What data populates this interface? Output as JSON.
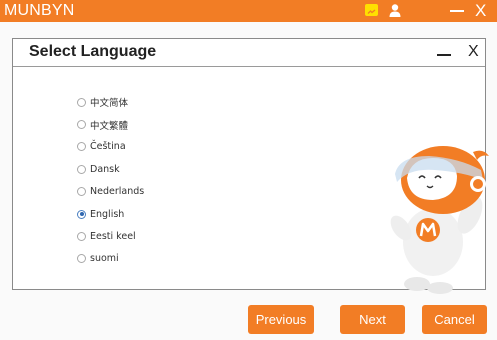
{
  "app": {
    "title": "MUNBYN",
    "close_glyph": "X",
    "accent_color": "#f27d25"
  },
  "dialog": {
    "title": "Select Language",
    "close_glyph": "X"
  },
  "languages": [
    {
      "label": "中文简体",
      "selected": false
    },
    {
      "label": "中文繁體",
      "selected": false
    },
    {
      "label": "Čeština",
      "selected": false
    },
    {
      "label": "Dansk",
      "selected": false
    },
    {
      "label": "Nederlands",
      "selected": false
    },
    {
      "label": "English",
      "selected": true
    },
    {
      "label": "Eesti keel",
      "selected": false
    },
    {
      "label": "suomi",
      "selected": false
    }
  ],
  "buttons": {
    "previous": "Previous",
    "next": "Next",
    "cancel": "Cancel"
  }
}
